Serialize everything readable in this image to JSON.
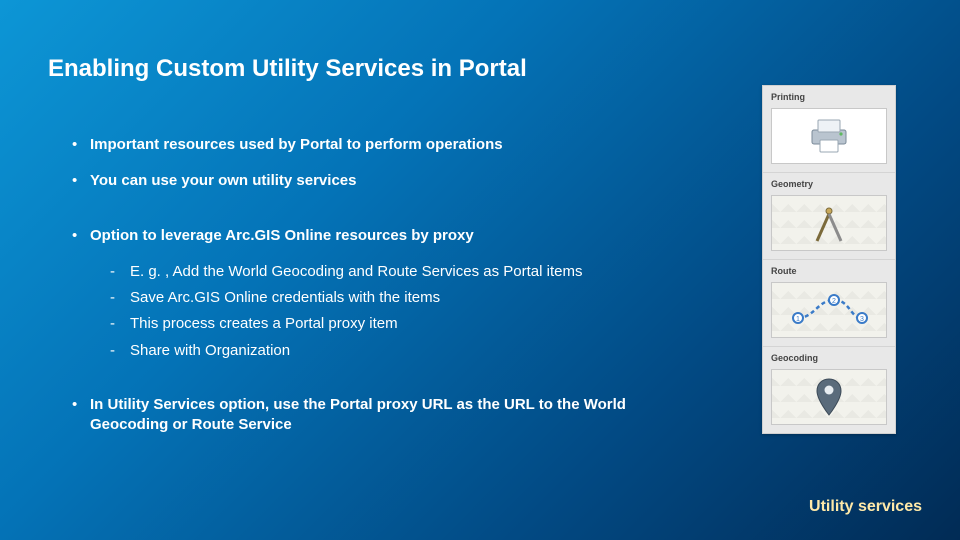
{
  "title": "Enabling Custom Utility Services in Portal",
  "bullets": {
    "b1": "Important resources used by Portal to perform operations",
    "b2": "You can use your own utility services",
    "b3": "Option to leverage Arc.GIS Online resources by proxy",
    "b3_sub": {
      "s1": "E. g. , Add the World Geocoding and Route Services as Portal items",
      "s2": "Save Arc.GIS Online credentials with the items",
      "s3": "This process creates a Portal proxy item",
      "s4": "Share with Organization"
    },
    "b4": "In Utility Services option, use the Portal proxy URL as the URL to the World Geocoding or Route Service"
  },
  "panel": {
    "printing": "Printing",
    "geometry": "Geometry",
    "route": "Route",
    "geocoding": "Geocoding"
  },
  "caption": "Utility services"
}
